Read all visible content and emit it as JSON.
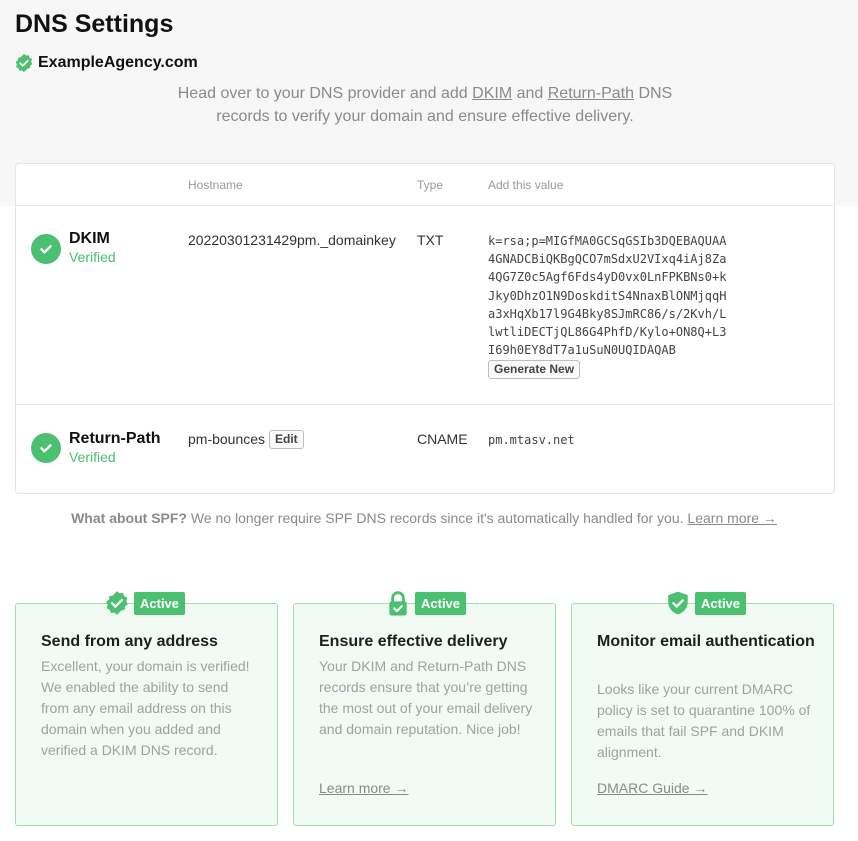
{
  "page": {
    "title": "DNS Settings",
    "domain": "ExampleAgency.com",
    "intro": {
      "part1": "Head over to your DNS provider and add ",
      "dkim_link": "DKIM",
      "and": " and ",
      "returnpath_link": "Return-Path",
      "part2": " DNS records to verify your domain and ensure effective delivery."
    }
  },
  "table": {
    "headers": {
      "hostname": "Hostname",
      "type": "Type",
      "value": "Add this value"
    },
    "records": [
      {
        "name": "DKIM",
        "status": "Verified",
        "hostname": "20220301231429pm._domainkey",
        "type": "TXT",
        "value_lines": [
          "k=rsa;p=MIGfMA0GCSqGSIb3DQEBAQUAA",
          "4GNADCBiQKBgQCO7mSdxU2VIxq4iAj8Za",
          "4QG7Z0c5Agf6Fds4yD0vx0LnFPKBNs0+k",
          "Jky0DhzO1N9DoskditS4NnaxBlONMjqqH",
          "a3xHqXb17l9G4Bky8SJmRC86/s/2Kvh/L",
          "lwtliDECTjQL86G4PhfD/Kylo+ON8Q+L3",
          "I69h0EY8dT7a1uSuN0UQIDAQAB"
        ],
        "action_label": "Generate New"
      },
      {
        "name": "Return-Path",
        "status": "Verified",
        "hostname": "pm-bounces",
        "edit_label": "Edit",
        "type": "CNAME",
        "value": "pm.mtasv.net"
      }
    ]
  },
  "spf": {
    "bold": "What about SPF?",
    "text": " We no longer require SPF DNS records since it's automatically handled for you. ",
    "link": "Learn more →"
  },
  "features": [
    {
      "icon": "verified-badge-icon",
      "badge": "Active",
      "title": "Send from any address",
      "body": "Excellent, your domain is verified! We enabled the ability to send from any email address on this domain when you added and verified a DKIM DNS record.",
      "link": ""
    },
    {
      "icon": "lock-icon",
      "badge": "Active",
      "title": "Ensure effective delivery",
      "body": "Your DKIM and Return-Path DNS records ensure that you’re getting the most out of your email delivery and domain reputation. Nice job!",
      "link": "Learn more →"
    },
    {
      "icon": "shield-check-icon",
      "badge": "Active",
      "title": "Monitor email authentication",
      "body": "Looks like your current DMARC policy is set to quarantine 100% of emails that fail SPF and DKIM alignment.",
      "link": "DMARC Guide →"
    }
  ],
  "colors": {
    "accent": "#4cc071",
    "card_bg": "#f1fbf3",
    "card_border": "#9ee0ae"
  }
}
